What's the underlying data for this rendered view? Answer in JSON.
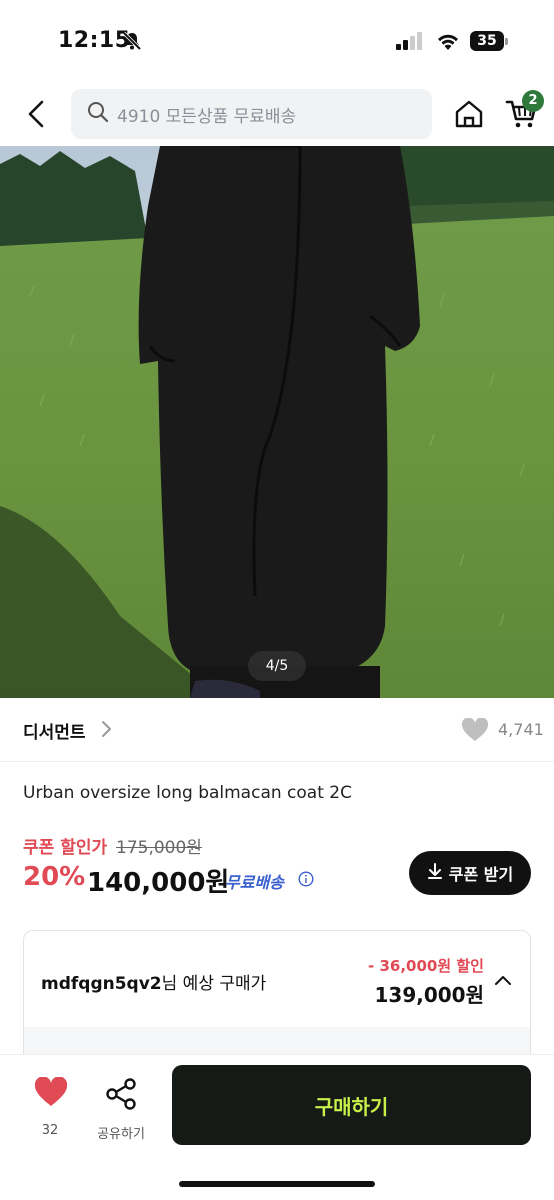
{
  "status_bar": {
    "time": "12:15",
    "battery": "35"
  },
  "header": {
    "search_text": "4910 모든상품 무료배송",
    "cart_count": "2"
  },
  "gallery": {
    "counter": "4/5"
  },
  "brand": {
    "name": "디서먼트",
    "like_count": "4,741"
  },
  "product": {
    "title": "Urban oversize long balmacan coat 2C",
    "coupon_label": "쿠폰 할인가",
    "original_price": "175,000원",
    "discount_percent": "20%",
    "sale_price": "140,000원",
    "shipping": "무료배송",
    "coupon_button": "쿠폰 받기"
  },
  "expected": {
    "user": "mdfqgn5qv2",
    "suffix": "님 예상 구매가",
    "discount": "- 36,000원 할인",
    "price": "139,000원"
  },
  "bottom_bar": {
    "heart_count": "32",
    "share_label": "공유하기",
    "buy_label": "구매하기"
  },
  "colors": {
    "accent_red": "#e04a55",
    "buy_button_bg": "#151a17",
    "buy_button_text": "#c8f04a",
    "free_shipping_blue": "#3a5fcf",
    "cart_badge": "#2f7a3b"
  }
}
